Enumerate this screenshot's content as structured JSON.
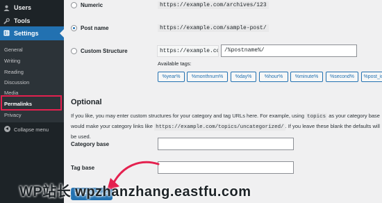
{
  "sidebar": {
    "menu": [
      {
        "label": "Users",
        "icon": "users-icon"
      },
      {
        "label": "Tools",
        "icon": "wrench-icon"
      },
      {
        "label": "Settings",
        "icon": "settings-icon"
      }
    ],
    "submenu": [
      "General",
      "Writing",
      "Reading",
      "Discussion",
      "Media",
      "Permalinks",
      "Privacy"
    ],
    "current_submenu": "Permalinks",
    "collapse_label": "Collapse menu",
    "active_color": "#2271b1",
    "highlight_color": "#e4214f"
  },
  "permalink_options": [
    {
      "label": "Numeric",
      "example": "https://example.com/archives/123",
      "checked": false
    },
    {
      "label": "Post name",
      "example": "https://example.com/sample-post/",
      "checked": true
    },
    {
      "label": "Custom Structure",
      "prefix": "https://example.com",
      "value": "/%postname%/",
      "checked": false
    }
  ],
  "available_tags_label": "Available tags:",
  "tags": [
    "%year%",
    "%monthnum%",
    "%day%",
    "%hour%",
    "%minute%",
    "%second%",
    "%post_id%"
  ],
  "optional": {
    "heading": "Optional",
    "description_start": "If you like, you may enter custom structures for your category and tag URLs here. For example, using",
    "description_code1": "topics",
    "description_mid": "as your category base would make your category links like",
    "description_code2": "https://example.com/topics/uncategorized/",
    "description_end": ". If you leave these blank the defaults will be used."
  },
  "fields": {
    "category_base_label": "Category base",
    "category_base_value": "",
    "tag_base_label": "Tag base",
    "tag_base_value": ""
  },
  "save_button_label": "Save Changes",
  "watermark": "WP站长 wpzhanzhang.eastfu.com"
}
